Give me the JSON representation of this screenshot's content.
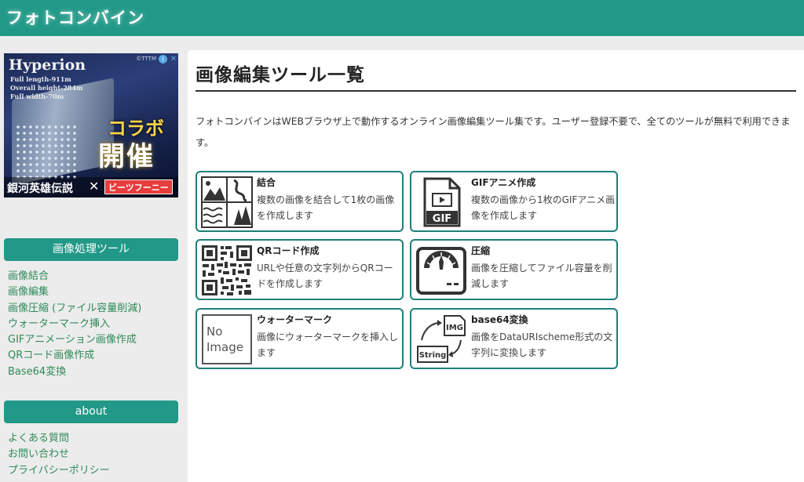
{
  "header": {
    "site_title": "フォトコンバイン"
  },
  "ad": {
    "title": "Hyperion",
    "specs": [
      "Full length-911m",
      "Overall height-284m",
      "Full width-70m"
    ],
    "brand": "©TTTM",
    "info_glyph": "i",
    "close_glyph": "✕",
    "collab": "コラボ",
    "event": "開催",
    "hero_title": "銀河英雄伝説",
    "x_mark": "✕",
    "partner": "ビーツフーニー"
  },
  "sidebar": {
    "tools_heading": "画像処理ツール",
    "tools": [
      "画像結合",
      "画像編集",
      "画像圧縮 (ファイル容量削減)",
      "ウォーターマーク挿入",
      "GIFアニメーション画像作成",
      "QRコード画像作成",
      "Base64変換"
    ],
    "about_heading": "about",
    "about_links": [
      "よくある質問",
      "お問い合わせ",
      "プライバシーポリシー"
    ]
  },
  "main": {
    "page_title": "画像編集ツール一覧",
    "intro": "フォトコンバインはWEBブラウザ上で動作するオンライン画像編集ツール集です。ユーザー登録不要で、全てのツールが無料で利用できます。",
    "cards": [
      {
        "title": "結合",
        "desc": "複数の画像を結合して1枚の画像を作成します",
        "icon": "image-grid-icon"
      },
      {
        "title": "GIFアニメ作成",
        "desc": "複数の画像から1枚のGIFアニメ画像を作成します",
        "icon": "gif-file-icon",
        "icon_text": "GIF"
      },
      {
        "title": "QRコード作成",
        "desc": "URLや任意の文字列からQRコードを作成します",
        "icon": "qr-code-icon"
      },
      {
        "title": "圧縮",
        "desc": "画像を圧縮してファイル容量を削減します",
        "icon": "scale-icon"
      },
      {
        "title": "ウォーターマーク",
        "desc": "画像にウォーターマークを挿入します",
        "icon": "no-image-icon",
        "icon_text": [
          "No",
          "Image"
        ]
      },
      {
        "title": "base64変換",
        "desc": "画像をDataURIscheme形式の文字列に変換します",
        "icon": "convert-icon",
        "icon_text": [
          "IMG",
          "String"
        ]
      }
    ]
  },
  "colors": {
    "accent": "#229988",
    "card_border": "#1e7f78",
    "link": "#2e8a58"
  }
}
